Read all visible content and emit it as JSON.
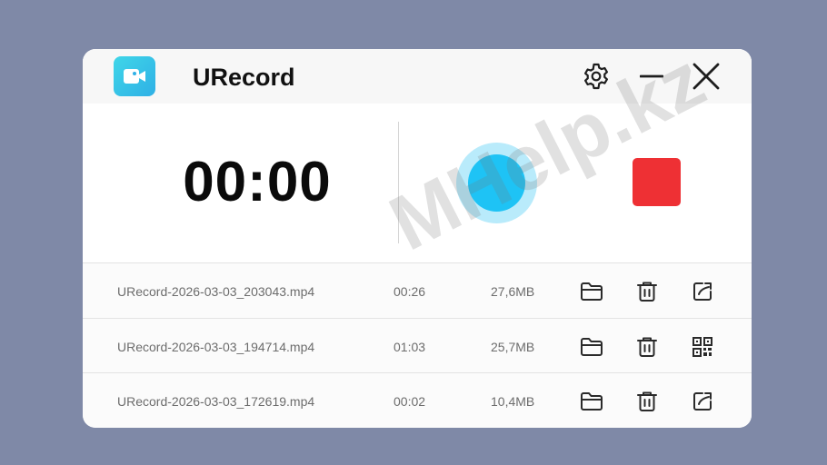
{
  "app": {
    "title": "URecord",
    "logo_icon": "video-camera-icon",
    "accent_color": "#1ec3f5",
    "stop_color": "#ee3034"
  },
  "titlebar": {
    "settings_icon": "gear-icon",
    "minimize_icon": "minimize-icon",
    "close_icon": "close-icon"
  },
  "recorder": {
    "timer": "00:00",
    "record_icon": "record-icon",
    "stop_icon": "stop-icon"
  },
  "recordings": [
    {
      "name": "URecord-2026-03-03_203043.mp4",
      "duration": "00:26",
      "size": "27,6MB",
      "action_icon": "share-icon"
    },
    {
      "name": "URecord-2026-03-03_194714.mp4",
      "duration": "01:03",
      "size": "25,7MB",
      "action_icon": "qr-code-icon"
    },
    {
      "name": "URecord-2026-03-03_172619.mp4",
      "duration": "00:02",
      "size": "10,4MB",
      "action_icon": "share-icon"
    }
  ],
  "watermark": "MHelp.kz"
}
